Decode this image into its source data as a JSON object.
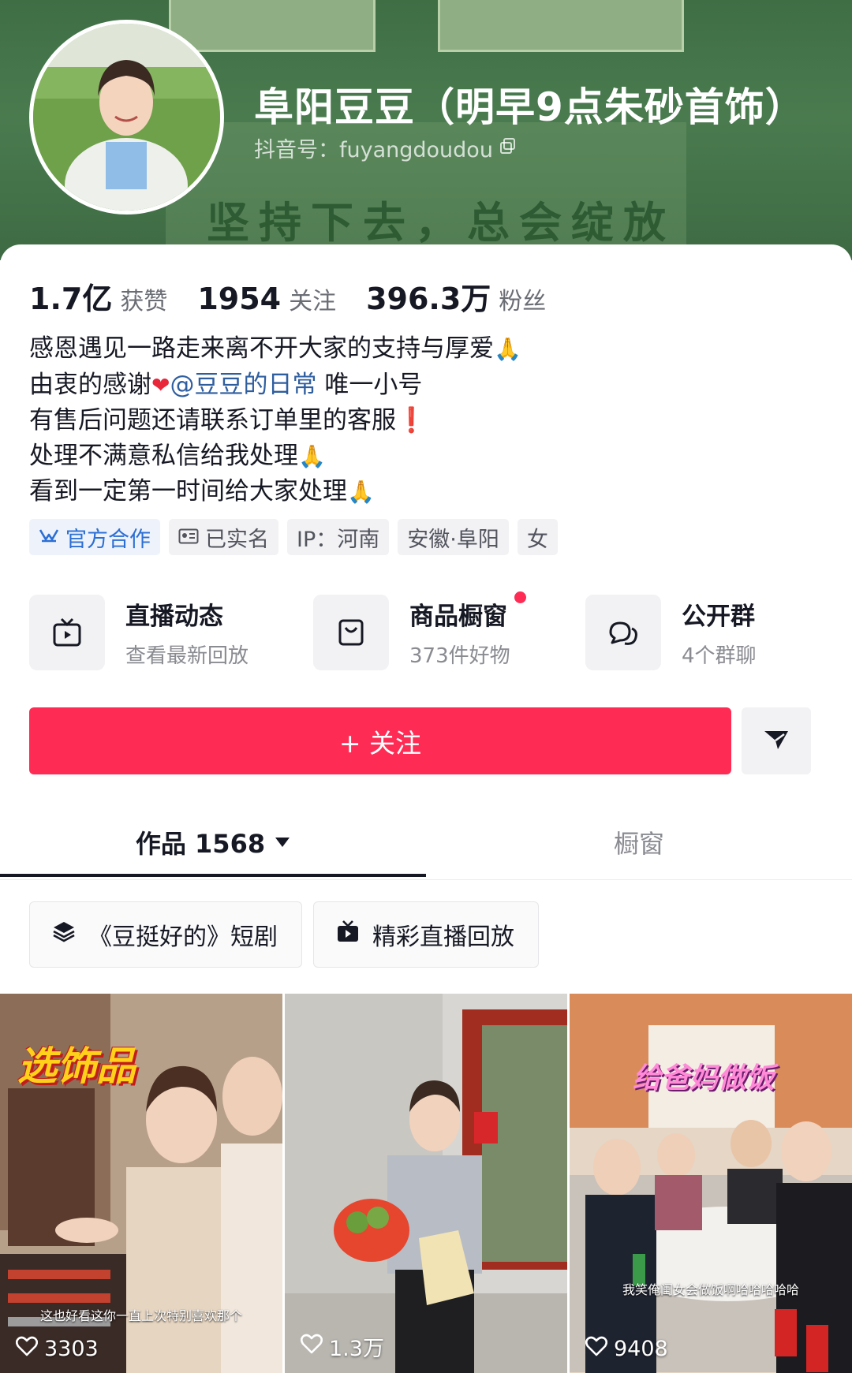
{
  "profile": {
    "nickname": "阜阳豆豆（明早9点朱砂首饰）",
    "douyin_id": "抖音号：fuyangdoudou",
    "cover_slogan": "坚持下去，总会绽放"
  },
  "stats": [
    {
      "num": "1.7亿",
      "label": "获赞"
    },
    {
      "num": "1954",
      "label": "关注"
    },
    {
      "num": "396.3万",
      "label": "粉丝"
    }
  ],
  "bio": {
    "line1": "感恩遇见一路走来离不开大家的支持与厚爱",
    "line2_pre": "由衷的感谢",
    "mention": "@豆豆的日常",
    "line2_post": " 唯一小号",
    "line3": "有售后问题还请联系订单里的客服",
    "line4": "处理不满意私信给我处理",
    "line5": "看到一定第一时间给大家处理",
    "pray_emoji": "🙏",
    "heart_emoji": "❤",
    "excl_emoji": "❗"
  },
  "tags": {
    "official": "官方合作",
    "verified": "已实名",
    "ip": "IP：河南",
    "location": "安徽·阜阳",
    "gender": "女"
  },
  "entries": [
    {
      "title": "直播动态",
      "subtitle": "查看最新回放",
      "icon": "tv-icon"
    },
    {
      "title": "商品橱窗",
      "subtitle": "373件好物",
      "icon": "shopping-bag-icon",
      "red_dot": true
    },
    {
      "title": "公开群",
      "subtitle": "4个群聊",
      "icon": "chat-bubbles-icon"
    }
  ],
  "actions": {
    "follow_label": "+ 关注",
    "share_icon": "send-icon"
  },
  "tabs": {
    "works_label": "作品 1568",
    "shop_label": "橱窗"
  },
  "chips": {
    "drama": "《豆挺好的》短剧",
    "live_replay": "精彩直播回放"
  },
  "videos": [
    {
      "overlay": "选饰品",
      "caption": "这也好看这你一直上次特别喜欢那个",
      "likes": "3303"
    },
    {
      "overlay": "",
      "caption": "",
      "likes": "1.3万"
    },
    {
      "overlay": "给爸妈做饭",
      "caption": "我笑俺闺女会做饭啊哈哈哈哈哈",
      "likes": "9408"
    }
  ],
  "colors": {
    "accent": "#fe2c55",
    "mention": "#2f5e9f",
    "official": "#2c6fd4"
  }
}
